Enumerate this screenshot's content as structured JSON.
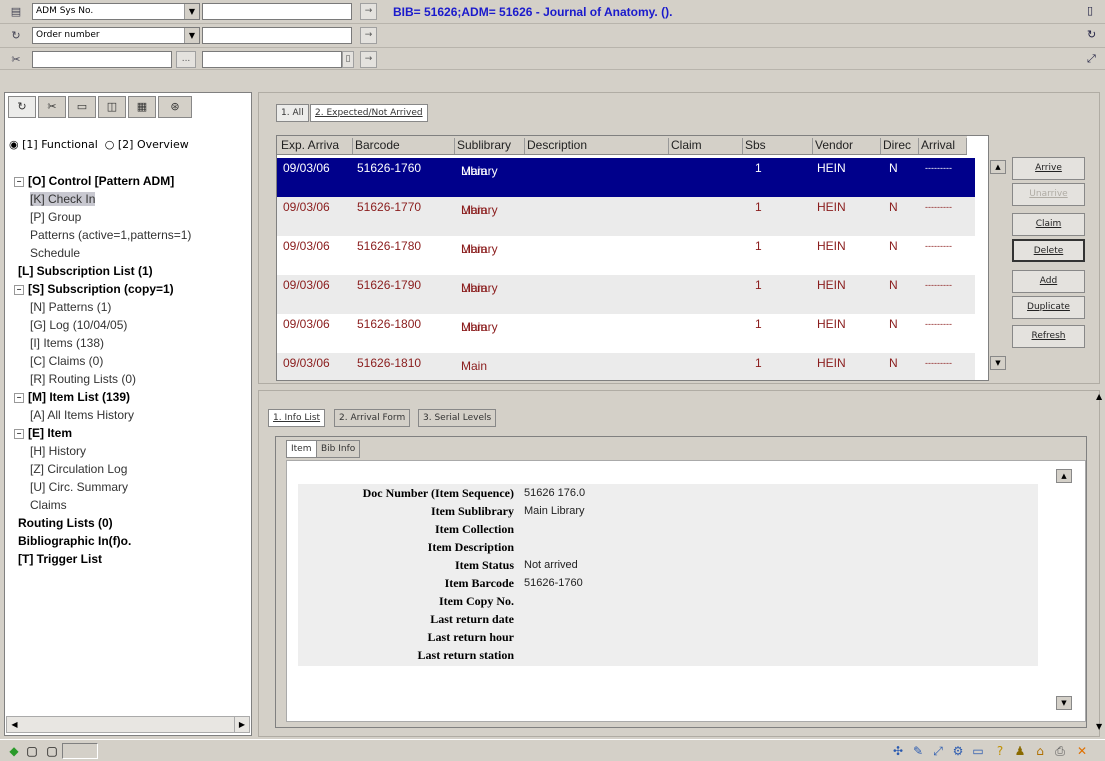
{
  "toolbar": {
    "row1": {
      "icon": "list-icon",
      "combo": "ADM Sys No.",
      "title": "BIB= 51626;ADM= 51626 - Journal of Anatomy. ()."
    },
    "row2": {
      "icon": "refresh-icon",
      "combo": "Order number"
    },
    "row3": {
      "icon": "scissors-icon",
      "browse": "..."
    }
  },
  "left": {
    "tabs": [
      {
        "icon": "refresh-icon"
      },
      {
        "icon": "scissors-icon"
      },
      {
        "icon": "clipboard-icon"
      },
      {
        "icon": "window-icon"
      },
      {
        "icon": "grid-icon"
      },
      {
        "icon": "binoculars-icon"
      }
    ],
    "radio1": "[1] Functional",
    "radio2": "[2] Overview",
    "tree": {
      "n0": "[O] Control [Pattern ADM]",
      "n0a": "[K] Check In",
      "n0b": "[P] Group",
      "n0c": "Patterns (active=1,patterns=1)",
      "n0d": "Schedule",
      "n1": "[L] Subscription List (1)",
      "n2": "[S] Subscription (copy=1)",
      "n2a": "[N] Patterns (1)",
      "n2b": "[G] Log (10/04/05)",
      "n2c": "[I] Items (138)",
      "n2d": "[C] Claims (0)",
      "n2e": "[R] Routing Lists (0)",
      "n3": "[M] Item List (139)",
      "n3a": "[A] All Items History",
      "n4": "[E] Item",
      "n4a": "[H] History",
      "n4b": "[Z] Circulation Log",
      "n4c": "[U] Circ. Summary",
      "n4d": "Claims",
      "n5": "Routing Lists (0)",
      "n6": "Bibliographic In(f)o.",
      "n7": "[T] Trigger List"
    }
  },
  "top": {
    "tabs": [
      "1. All",
      "2. Expected/Not Arrived"
    ],
    "columns": [
      "Exp. Arriva",
      "Barcode",
      "Sublibrary",
      "Description",
      "Claim",
      "Sbs",
      "Vendor",
      "Direc",
      "Arrival"
    ],
    "rows": [
      {
        "exp": "09/03/06",
        "barcode": "51626-1760",
        "sub1": "Main",
        "sub2": "Library",
        "sbs": "1",
        "vendor": "HEIN",
        "dir": "N",
        "arrival": "---------"
      },
      {
        "exp": "09/03/06",
        "barcode": "51626-1770",
        "sub1": "Main",
        "sub2": "Library",
        "sbs": "1",
        "vendor": "HEIN",
        "dir": "N",
        "arrival": "---------"
      },
      {
        "exp": "09/03/06",
        "barcode": "51626-1780",
        "sub1": "Main",
        "sub2": "Library",
        "sbs": "1",
        "vendor": "HEIN",
        "dir": "N",
        "arrival": "---------"
      },
      {
        "exp": "09/03/06",
        "barcode": "51626-1790",
        "sub1": "Main",
        "sub2": "Library",
        "sbs": "1",
        "vendor": "HEIN",
        "dir": "N",
        "arrival": "---------"
      },
      {
        "exp": "09/03/06",
        "barcode": "51626-1800",
        "sub1": "Main",
        "sub2": "Library",
        "sbs": "1",
        "vendor": "HEIN",
        "dir": "N",
        "arrival": "---------"
      },
      {
        "exp": "09/03/06",
        "barcode": "51626-1810",
        "sub1": "Main",
        "sub2": "",
        "sbs": "1",
        "vendor": "HEIN",
        "dir": "N",
        "arrival": "---------"
      }
    ],
    "buttons": {
      "arrive": "Arrive",
      "unarrive": "Unarrive",
      "claim": "Claim",
      "delete": "Delete",
      "add": "Add",
      "duplicate": "Duplicate",
      "refresh": "Refresh"
    }
  },
  "bottom": {
    "tabs": [
      "1. Info List",
      "2. Arrival Form",
      "3. Serial Levels"
    ],
    "subtabs": [
      "Item",
      "Bib Info"
    ],
    "fields": [
      {
        "label": "Doc Number (Item Sequence)",
        "value": "51626 176.0"
      },
      {
        "label": "Item Sublibrary",
        "value": "Main Library"
      },
      {
        "label": "Item Collection",
        "value": ""
      },
      {
        "label": "Item Description",
        "value": ""
      },
      {
        "label": "Item Status",
        "value": "Not arrived"
      },
      {
        "label": "Item Barcode",
        "value": "51626-1760"
      },
      {
        "label": "Item Copy No.",
        "value": ""
      },
      {
        "label": "Last return date",
        "value": ""
      },
      {
        "label": "Last return hour",
        "value": ""
      },
      {
        "label": "Last return station",
        "value": ""
      }
    ]
  }
}
